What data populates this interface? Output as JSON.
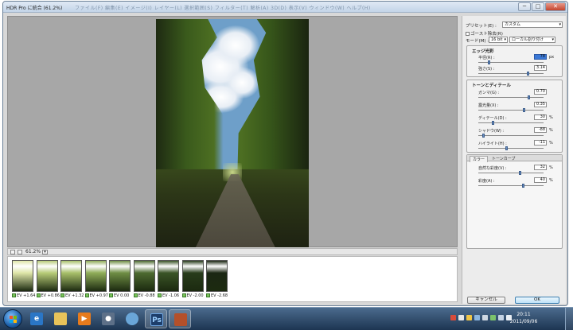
{
  "window": {
    "title": "HDR Pro に統合 (61.2%)",
    "faded_title": "ファイル(F)  編集(E)  イメージ(I)  レイヤー(L)  選択範囲(S)  フィルター(T)  解析(A)  3D(D)  表示(V)  ウィンドウ(W)  ヘルプ(H)",
    "min_label": "─",
    "max_label": "□",
    "close_label": "✕"
  },
  "zoom": {
    "value": "61.2%"
  },
  "filmstrip": [
    {
      "label": "EV +1.64",
      "tone": "#dfe6a8"
    },
    {
      "label": "EV +0.86",
      "tone": "#b8cc78"
    },
    {
      "label": "EV +1.32",
      "tone": "#a8c06a"
    },
    {
      "label": "EV +0.97",
      "tone": "#90ad58"
    },
    {
      "label": "EV 0.00",
      "tone": "#6f8e44"
    },
    {
      "label": "EV -0.88",
      "tone": "#4d6a30"
    },
    {
      "label": "EV -1.06",
      "tone": "#3a5426"
    },
    {
      "label": "EV -2.00",
      "tone": "#283c1b"
    },
    {
      "label": "EV -2.68",
      "tone": "#1b2713"
    }
  ],
  "panel": {
    "preset_label": "プリセット(E) :",
    "preset_value": "カスタム",
    "remove_ghost_label": "ゴースト除去(R)",
    "mode_label": "モード(M) :",
    "mode_bits": "16 bit",
    "mode_method": "ローカル割り付け",
    "edge_glow": {
      "title": "エッジ光彩",
      "radius_label": "半径(R) :",
      "radius_value": "78",
      "radius_unit": "px",
      "radius_level": 0.16,
      "strength_label": "強さ(S) :",
      "strength_value": "3.14",
      "strength_level": 0.78
    },
    "tone_detail": {
      "title": "トーンとディテール",
      "gamma_label": "ガンマ(G) :",
      "gamma_value": "0.70",
      "gamma_level": 0.8,
      "exposure_label": "露光量(X) :",
      "exposure_value": "0.35",
      "exposure_level": 0.72,
      "detail_label": "ディテール(D) :",
      "detail_value": "30",
      "detail_unit": "%",
      "detail_level": 0.22,
      "shadow_label": "シャドウ(W) :",
      "shadow_value": "-88",
      "shadow_unit": "%",
      "shadow_level": 0.06,
      "highlight_label": "ハイライト(H) :",
      "highlight_value": "-11",
      "highlight_unit": "%",
      "highlight_level": 0.44
    },
    "color_tab": {
      "tab1": "カラー",
      "tab2": "トーンカーブ",
      "vibrance_label": "自然な彩度(V) :",
      "vibrance_value": "32",
      "vibrance_unit": "%",
      "vibrance_level": 0.66,
      "saturation_label": "彩度(A) :",
      "saturation_value": "40",
      "saturation_unit": "%",
      "saturation_level": 0.7
    },
    "cancel_label": "キャンセル",
    "ok_label": "OK"
  },
  "taskbar": {
    "photoshop_label": "Ps",
    "clock_time": "20:11",
    "clock_date": "2011/09/06"
  },
  "colors": {
    "accent": "#3a78d6",
    "checkbox": "#7ac35a"
  }
}
